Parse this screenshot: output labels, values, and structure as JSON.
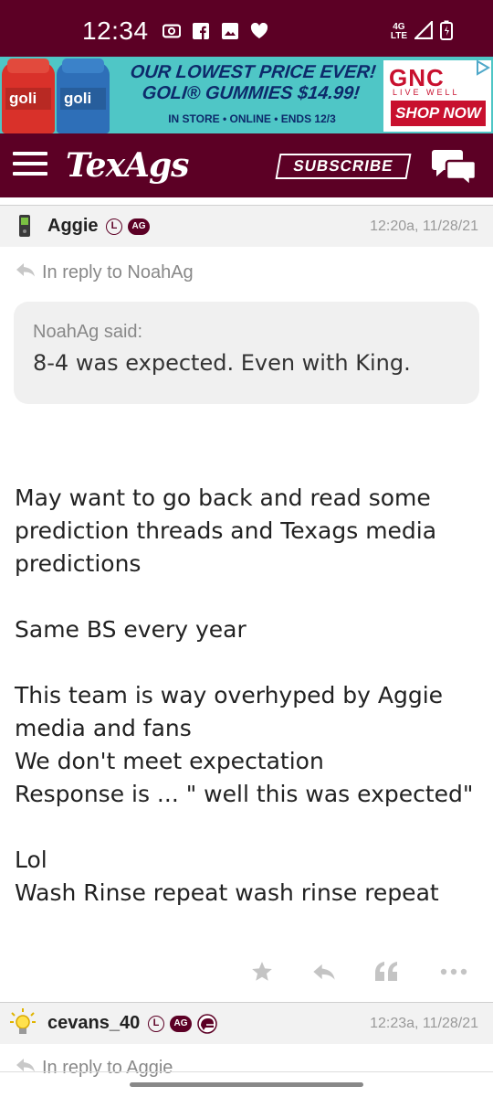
{
  "status_bar": {
    "time": "12:34",
    "network": "4G\nLTE",
    "icons": [
      "camera-icon",
      "facebook-icon",
      "image-icon",
      "heart-icon",
      "signal-icon",
      "battery-icon"
    ]
  },
  "ad": {
    "headline_1": "OUR LOWEST PRICE EVER!",
    "headline_2": "GOLI® GUMMIES $14.99!",
    "subline": "IN STORE • ONLINE • ENDS 12/3",
    "bottle_1_label": "goli",
    "bottle_2_label": "goli",
    "brand": "GNC",
    "brand_tagline": "LIVE WELL",
    "cta": "SHOP NOW"
  },
  "app_header": {
    "logo": "TexAgs",
    "subscribe_label": "SUBSCRIBE"
  },
  "post": {
    "username": "Aggie",
    "badge_l": "L",
    "badge_ag": "AG",
    "timestamp": "12:20a, 11/28/21",
    "reply_to": "In reply to NoahAg",
    "quote_author": "NoahAg said:",
    "quote_text": "8-4 was expected. Even with King.",
    "body": {
      "p1": "May want to go back and read some prediction threads and Texags media predictions",
      "p2": "Same BS every year",
      "p3a": "This team is way overhyped by Aggie media and fans",
      "p3b": "We don't meet expectation",
      "p3c": "Response is ... \" well this was expected\"",
      "p4a": "Lol",
      "p4b": "Wash Rinse repeat wash rinse repeat"
    }
  },
  "next_post": {
    "username": "cevans_40",
    "badge_l": "L",
    "badge_ag": "AG",
    "timestamp": "12:23a, 11/28/21",
    "reply_to": "In reply to Aggie"
  },
  "colors": {
    "maroon": "#5c0025",
    "ad_teal": "#4fc6c6",
    "gnc_red": "#c8102e"
  }
}
